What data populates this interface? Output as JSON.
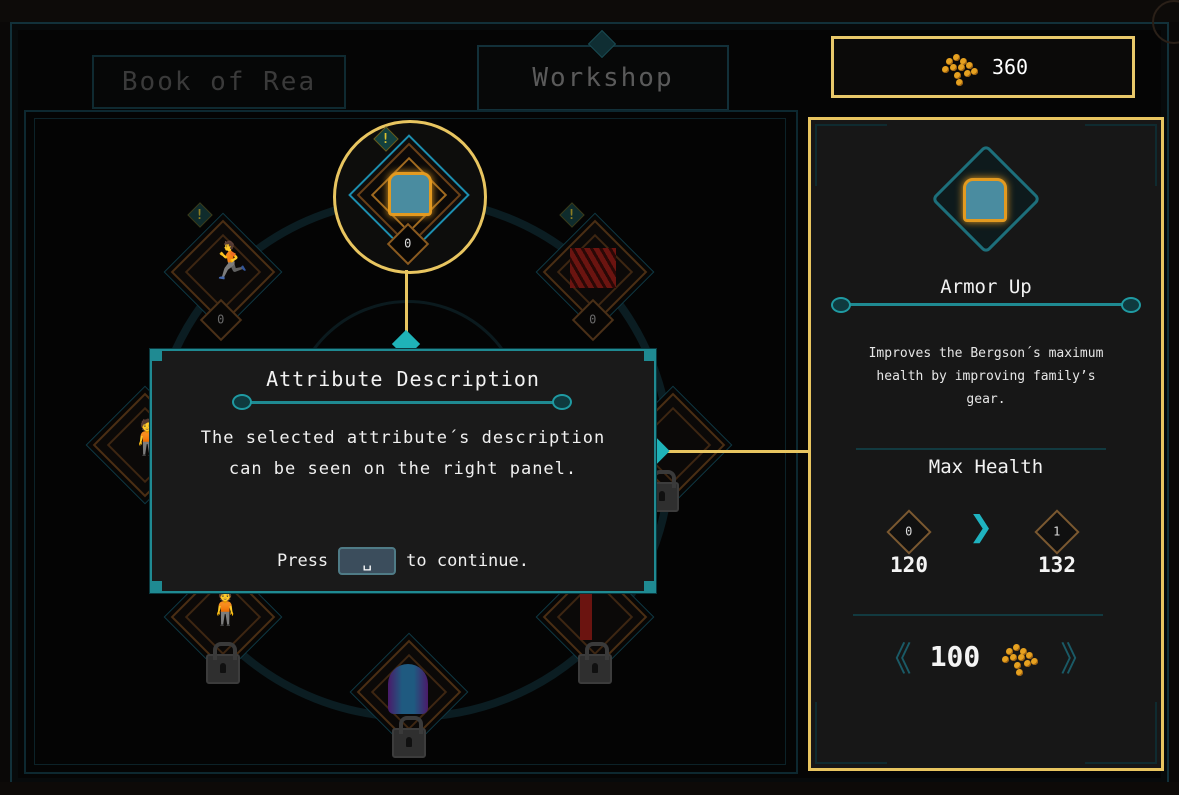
{
  "tabs": [
    {
      "label": "Book of Rea",
      "active": false
    },
    {
      "label": "Workshop",
      "active": true
    }
  ],
  "currency": {
    "icon": "gold-coins-icon",
    "amount": "360"
  },
  "skill_tree": {
    "nodes": [
      {
        "id": "armor-up",
        "icon": "armor-icon",
        "level": "0",
        "alert": "!",
        "selected": true,
        "locked": false
      },
      {
        "id": "speed",
        "icon": "running-figure-icon",
        "level": "0",
        "alert": "!",
        "selected": false,
        "locked": false
      },
      {
        "id": "claw",
        "icon": "claw-icon",
        "level": "0",
        "alert": "!",
        "selected": false,
        "locked": false
      },
      {
        "id": "left-mid",
        "icon": "figure-icon",
        "locked": false
      },
      {
        "id": "right-mid",
        "icon": "figure-icon",
        "locked": true
      },
      {
        "id": "lower-left",
        "icon": "figure-sparks-icon",
        "locked": true
      },
      {
        "id": "lower-right",
        "icon": "lightning-tree-icon",
        "locked": true
      },
      {
        "id": "bottom",
        "icon": "spirit-icon",
        "locked": true
      }
    ]
  },
  "dialog": {
    "title": "Attribute Description",
    "body_line1": "The selected attribute´s description",
    "body_line2": "can be seen on the right panel.",
    "prompt_before": "Press",
    "key_glyph": "␣",
    "prompt_after": "to continue."
  },
  "detail_panel": {
    "icon": "armor-icon",
    "title": "Armor Up",
    "description_line1": "Improves the Bergson´s maximum",
    "description_line2": "health by improving family’s",
    "description_line3": "gear.",
    "stat_name": "Max Health",
    "current_level": "0",
    "current_value": "120",
    "next_level": "1",
    "next_value": "132",
    "arrow": "❯",
    "cost": "100",
    "cost_icon": "gold-coins-icon",
    "prev_arrow": "《",
    "next_arrow": "》"
  },
  "colors": {
    "accent_gold": "#e8c560",
    "accent_teal": "#1f8a92",
    "panel_bg": "#171717"
  }
}
